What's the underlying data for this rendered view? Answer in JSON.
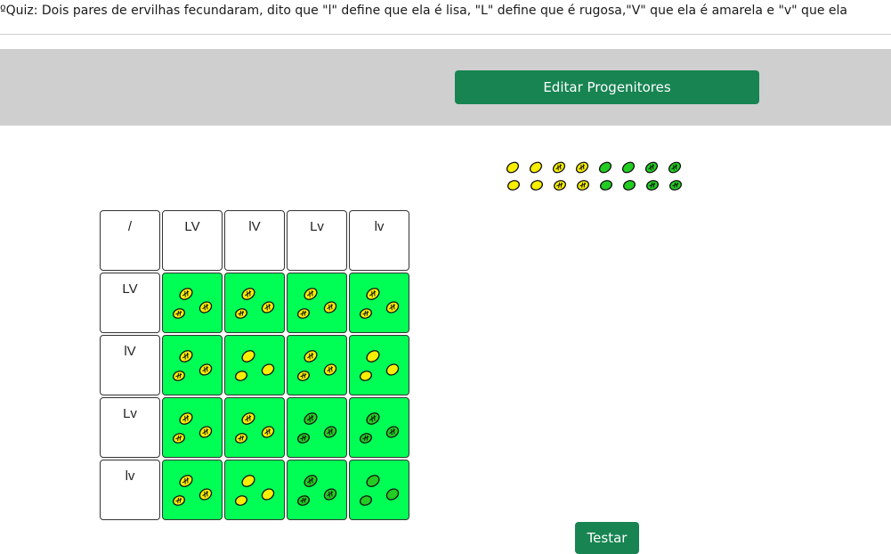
{
  "quiz": {
    "title": "ºQuiz: Dois pares de ervilhas fecundaram, dito que \"l\" define que ela é lisa, \"L\" define que é rugosa,\"V\" que ela é amarela e \"v\" que ela"
  },
  "toolbar": {
    "edit_label": "Editar Progenitores"
  },
  "actions": {
    "test_label": "Testar"
  },
  "colors": {
    "yellow": "#f7ee00",
    "green": "#22cc22",
    "cell_green": "#00ff55",
    "button": "#178452"
  },
  "legend_peas": [
    {
      "texture": "smooth",
      "color": "yellow"
    },
    {
      "texture": "smooth",
      "color": "yellow"
    },
    {
      "texture": "wrinkled",
      "color": "yellow"
    },
    {
      "texture": "wrinkled",
      "color": "yellow"
    },
    {
      "texture": "smooth",
      "color": "green"
    },
    {
      "texture": "smooth",
      "color": "green"
    },
    {
      "texture": "wrinkled",
      "color": "green"
    },
    {
      "texture": "wrinkled",
      "color": "green"
    }
  ],
  "punnett": {
    "corner": "/",
    "columns": [
      "LV",
      "lV",
      "Lv",
      "lv"
    ],
    "rows": [
      {
        "label": "LV",
        "cells": [
          {
            "texture": "wrinkled",
            "color": "yellow"
          },
          {
            "texture": "wrinkled",
            "color": "yellow"
          },
          {
            "texture": "wrinkled",
            "color": "yellow"
          },
          {
            "texture": "wrinkled",
            "color": "yellow"
          }
        ]
      },
      {
        "label": "lV",
        "cells": [
          {
            "texture": "wrinkled",
            "color": "yellow"
          },
          {
            "texture": "smooth",
            "color": "yellow"
          },
          {
            "texture": "wrinkled",
            "color": "yellow"
          },
          {
            "texture": "smooth",
            "color": "yellow"
          }
        ]
      },
      {
        "label": "Lv",
        "cells": [
          {
            "texture": "wrinkled",
            "color": "yellow"
          },
          {
            "texture": "wrinkled",
            "color": "yellow"
          },
          {
            "texture": "wrinkled",
            "color": "green"
          },
          {
            "texture": "wrinkled",
            "color": "green"
          }
        ]
      },
      {
        "label": "lv",
        "cells": [
          {
            "texture": "wrinkled",
            "color": "yellow"
          },
          {
            "texture": "smooth",
            "color": "yellow"
          },
          {
            "texture": "wrinkled",
            "color": "green"
          },
          {
            "texture": "smooth",
            "color": "green"
          }
        ]
      }
    ]
  }
}
